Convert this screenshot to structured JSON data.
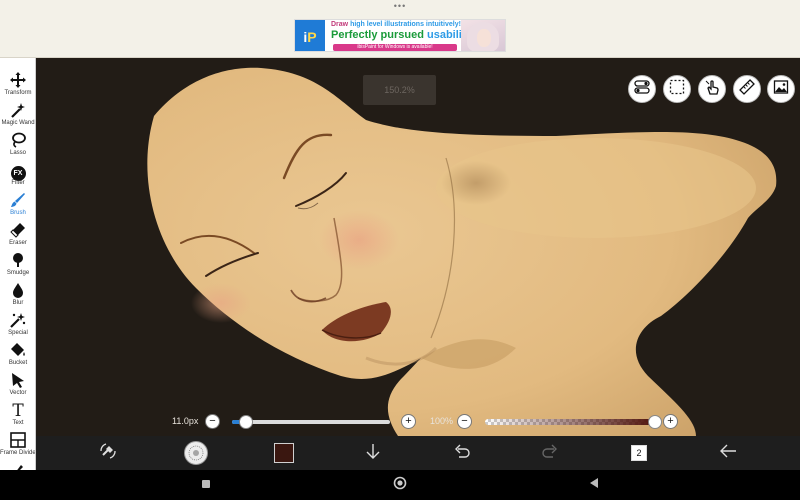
{
  "ad": {
    "dots": "•••",
    "logo_i": "i",
    "logo_p": "P",
    "line1_a": "Draw ",
    "line1_b": "high level illustrations intuitively!",
    "line2_a": "Perfectly pursued ",
    "line2_b": "usability!",
    "line3": "ibisPaint for Windows is available!"
  },
  "toolbar": {
    "items": [
      {
        "label": "Transform",
        "icon": "move-arrows-icon"
      },
      {
        "label": "Magic Wand",
        "icon": "magic-wand-icon"
      },
      {
        "label": "Lasso",
        "icon": "lasso-icon"
      },
      {
        "label": "Filter",
        "icon": "fx-icon",
        "glyph": "FX"
      },
      {
        "label": "Brush",
        "icon": "brush-icon",
        "active": true
      },
      {
        "label": "Eraser",
        "icon": "eraser-icon"
      },
      {
        "label": "Smudge",
        "icon": "smudge-icon"
      },
      {
        "label": "Blur",
        "icon": "droplet-icon"
      },
      {
        "label": "Special",
        "icon": "sparkle-wand-icon"
      },
      {
        "label": "Bucket",
        "icon": "bucket-icon"
      },
      {
        "label": "Vector",
        "icon": "cursor-arrow-icon"
      },
      {
        "label": "Text",
        "icon": "text-t-icon",
        "glyph": "T"
      },
      {
        "label": "Frame Divider",
        "icon": "frame-divider-icon"
      }
    ]
  },
  "canvas": {
    "zoom_label": "150.2%"
  },
  "sliders": {
    "brush_size_label": "11.0px",
    "brush_size_fraction": 0.09,
    "opacity_label": "100%",
    "opacity_fraction": 1.0
  },
  "bottombar": {
    "layer_count": "2"
  },
  "colors": {
    "accent": "#2a7fd4",
    "current_color": "#3a1710",
    "skin": "#e3bd82",
    "background": "#221c16"
  }
}
